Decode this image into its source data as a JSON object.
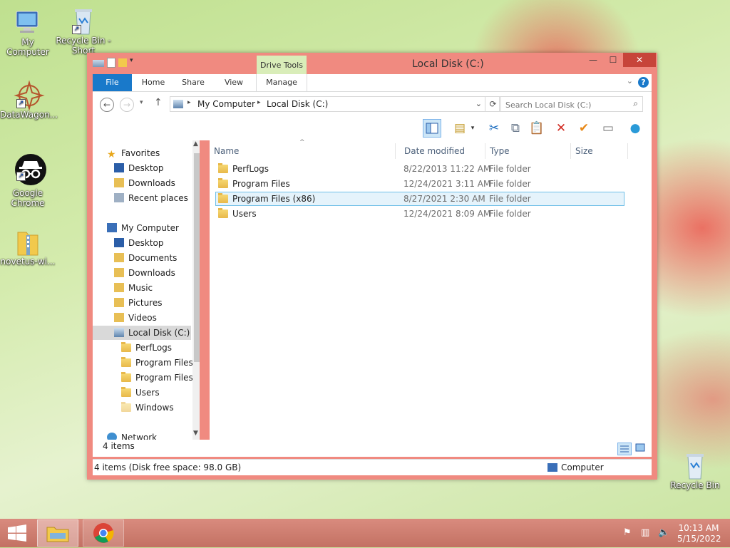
{
  "desktop": {
    "icons": [
      {
        "label": "My Computer"
      },
      {
        "label": "Recycle Bin - Short"
      },
      {
        "label": "DataWagon..."
      },
      {
        "label": "Google Chrome"
      },
      {
        "label": "novetus-wi..."
      },
      {
        "label": "Recycle Bin"
      }
    ]
  },
  "window": {
    "title": "Local Disk (C:)",
    "context_tab_group": "Drive Tools",
    "help": "?",
    "controls": {
      "minimize": "—",
      "maximize": "☐",
      "close": "✕"
    }
  },
  "ribbon": {
    "tabs": [
      "File",
      "Home",
      "Share",
      "View",
      "Manage"
    ]
  },
  "address": {
    "crumbs": [
      "My Computer",
      "Local Disk (C:)"
    ],
    "search_placeholder": "Search Local Disk (C:)"
  },
  "nav_pane": {
    "favorites": {
      "label": "Favorites",
      "items": [
        "Desktop",
        "Downloads",
        "Recent places"
      ]
    },
    "computer": {
      "label": "My Computer",
      "items": [
        "Desktop",
        "Documents",
        "Downloads",
        "Music",
        "Pictures",
        "Videos",
        "Local Disk (C:)"
      ]
    },
    "drive_children": [
      "PerfLogs",
      "Program Files",
      "Program Files (",
      "Users",
      "Windows"
    ],
    "network": "Network"
  },
  "columns": [
    "Name",
    "Date modified",
    "Type",
    "Size"
  ],
  "files": [
    {
      "name": "PerfLogs",
      "date": "8/22/2013 11:22 AM",
      "type": "File folder"
    },
    {
      "name": "Program Files",
      "date": "12/24/2021 3:11 AM",
      "type": "File folder"
    },
    {
      "name": "Program Files (x86)",
      "date": "8/27/2021 2:30 AM",
      "type": "File folder"
    },
    {
      "name": "Users",
      "date": "12/24/2021 8:09 AM",
      "type": "File folder"
    }
  ],
  "item_count": "4 items",
  "status": {
    "left": "4 items (Disk free space: 98.0 GB)",
    "right": "Computer"
  },
  "taskbar": {
    "time": "10:13 AM",
    "date": "5/15/2022"
  }
}
